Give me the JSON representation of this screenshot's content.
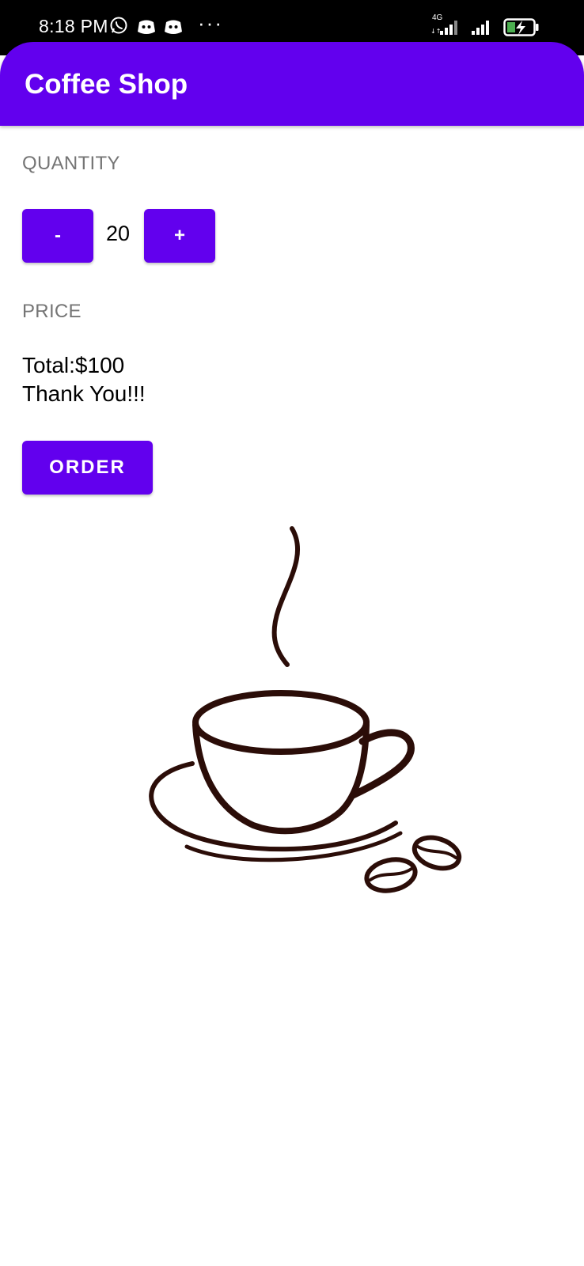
{
  "status_bar": {
    "time": "8:18 PM",
    "overflow": "···",
    "network_label": "4G",
    "icons": [
      "whatsapp-icon",
      "discord-icon",
      "discord-icon",
      "signal-icon",
      "signal-icon",
      "battery-charging-icon"
    ]
  },
  "app_bar": {
    "title": "Coffee Shop"
  },
  "quantity": {
    "label": "QUANTITY",
    "decrement_label": "-",
    "value": "20",
    "increment_label": "+"
  },
  "price": {
    "label": "PRICE",
    "total": "Total:$100",
    "message": "Thank You!!!"
  },
  "order": {
    "button_label": "ORDER"
  },
  "image": {
    "icon": "coffee-cup-illustration"
  },
  "colors": {
    "primary": "#6200ee",
    "label_gray": "#757575",
    "coffee_brown": "#2b0d08"
  }
}
